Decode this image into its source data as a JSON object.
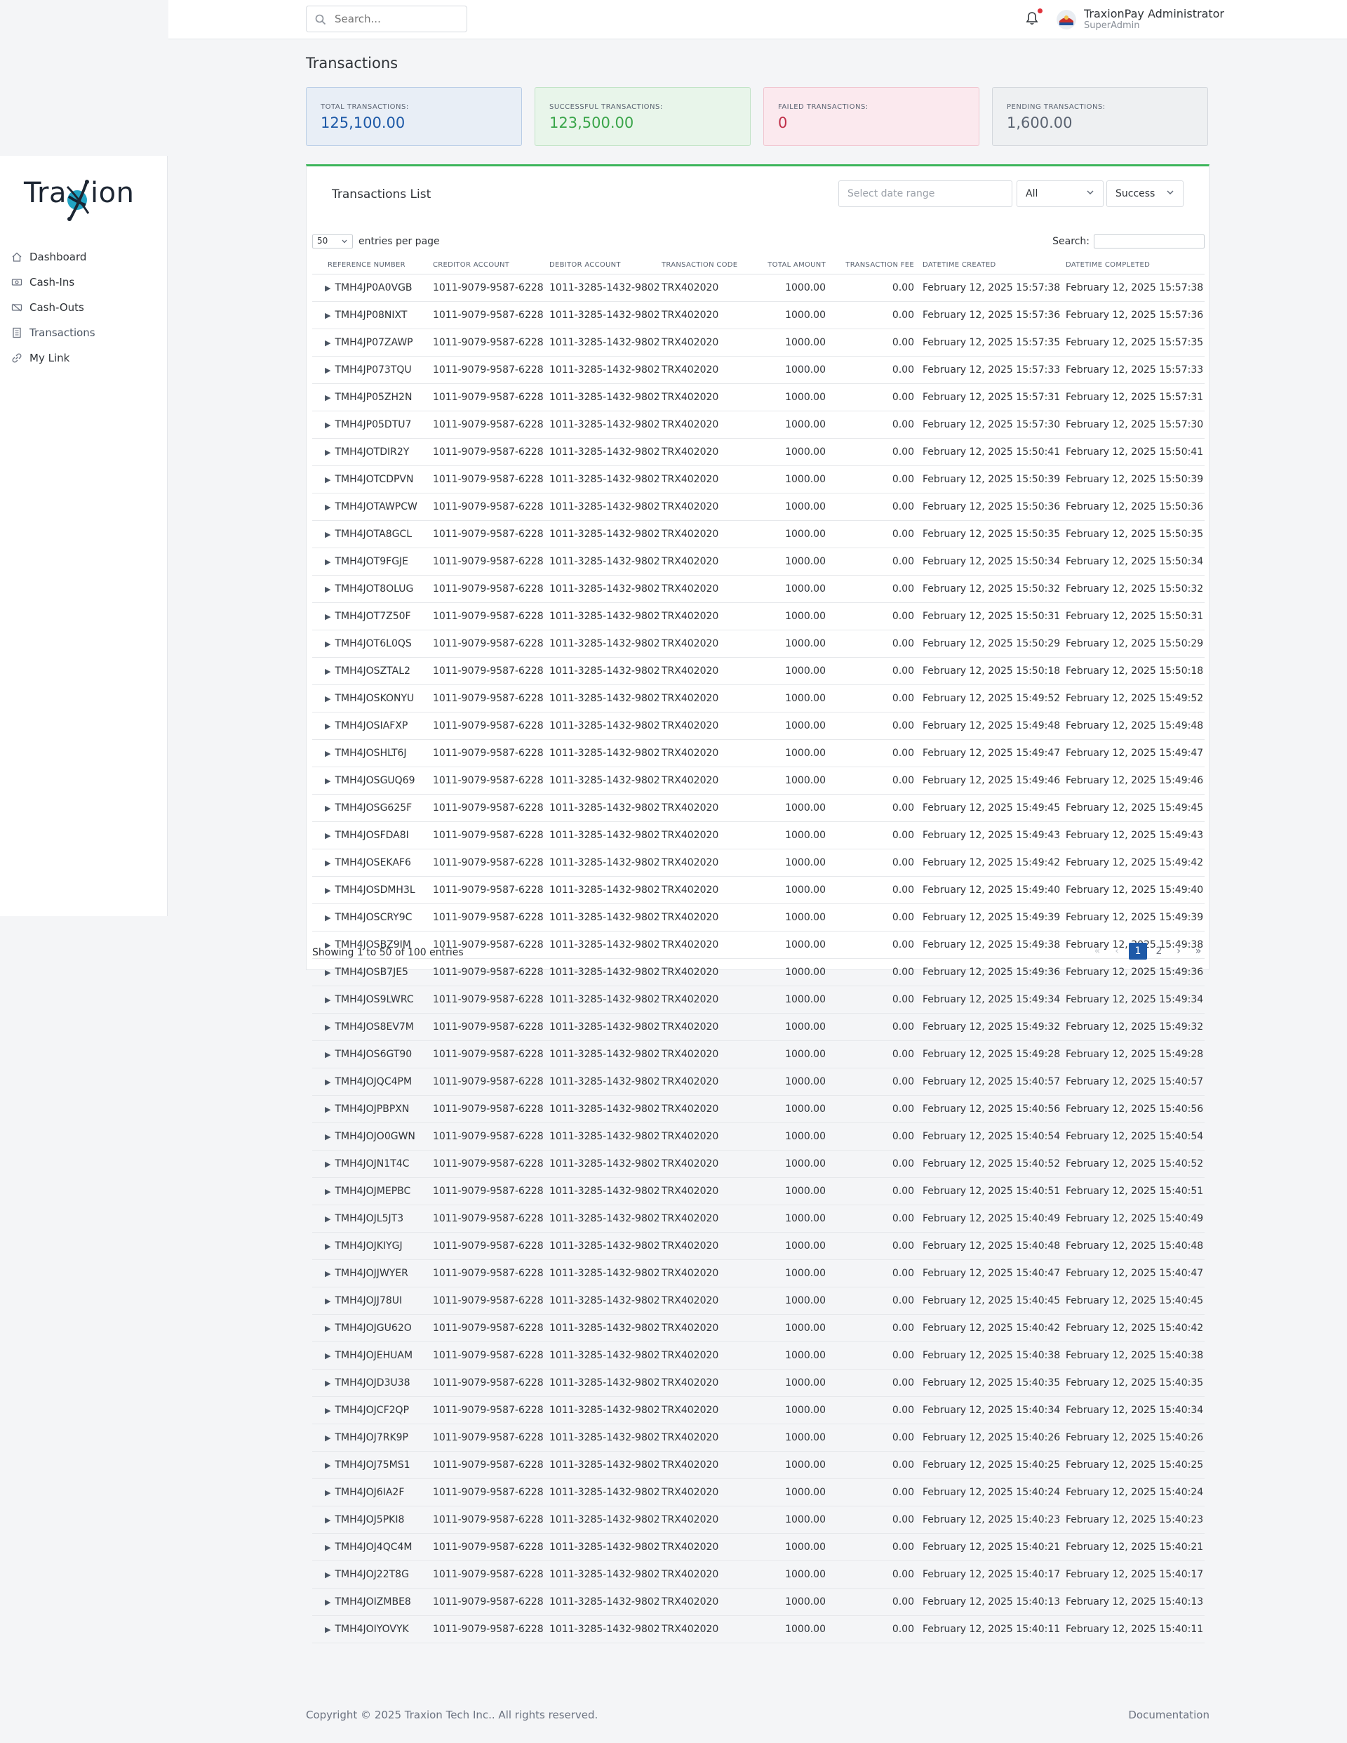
{
  "topbar": {
    "search_placeholder": "Search...",
    "user_name": "TraxionPay Administrator",
    "user_role": "SuperAdmin"
  },
  "sidebar": {
    "logo_text_left": "Tra",
    "logo_text_right": "ion",
    "items": [
      {
        "label": "Dashboard",
        "icon": "home-icon"
      },
      {
        "label": "Cash-Ins",
        "icon": "cash-in-icon"
      },
      {
        "label": "Cash-Outs",
        "icon": "cash-out-icon"
      },
      {
        "label": "Transactions",
        "icon": "receipt-icon",
        "active": true
      },
      {
        "label": "My Link",
        "icon": "link-icon"
      }
    ]
  },
  "page": {
    "title": "Transactions"
  },
  "summary_cards": [
    {
      "label": "TOTAL TRANSACTIONS:",
      "value": "125,100.00",
      "color": "#1e5aa8",
      "bg": "#e8eef6",
      "border": "#b9cde6"
    },
    {
      "label": "SUCCESSFUL TRANSACTIONS:",
      "value": "123,500.00",
      "color": "#3aa54a",
      "bg": "#e8f5ea",
      "border": "#c1e3c6"
    },
    {
      "label": "FAILED TRANSACTIONS:",
      "value": "0",
      "color": "#c0314a",
      "bg": "#fbe9ee",
      "border": "#f0c5cf"
    },
    {
      "label": "PENDING TRANSACTIONS:",
      "value": "1,600.00",
      "color": "#5b6472",
      "bg": "#eef0f2",
      "border": "#d3d7dc"
    }
  ],
  "panel": {
    "title": "Transactions List",
    "date_range_placeholder": "Select date range",
    "type_filter": "All",
    "status_filter": "Success",
    "entries_per_page": "50",
    "entries_label": "entries per page",
    "search_label": "Search:"
  },
  "table": {
    "columns": [
      "REFERENCE NUMBER",
      "CREDITOR ACCOUNT",
      "DEBITOR ACCOUNT",
      "TRANSACTION CODE",
      "TOTAL AMOUNT",
      "TRANSACTION FEE",
      "DATETIME CREATED",
      "DATETIME COMPLETED"
    ],
    "creditor": "1011-9079-9587-6228",
    "debitor": "1011-3285-1432-9802",
    "code": "TRX402020",
    "amount": "1000.00",
    "fee": "0.00",
    "rows": [
      {
        "ref": "TMH4JP0A0VGB",
        "created": "February 12, 2025 15:57:38",
        "completed": "February 12, 2025 15:57:38"
      },
      {
        "ref": "TMH4JP08NIXT",
        "created": "February 12, 2025 15:57:36",
        "completed": "February 12, 2025 15:57:36"
      },
      {
        "ref": "TMH4JP07ZAWP",
        "created": "February 12, 2025 15:57:35",
        "completed": "February 12, 2025 15:57:35"
      },
      {
        "ref": "TMH4JP073TQU",
        "created": "February 12, 2025 15:57:33",
        "completed": "February 12, 2025 15:57:33"
      },
      {
        "ref": "TMH4JP05ZH2N",
        "created": "February 12, 2025 15:57:31",
        "completed": "February 12, 2025 15:57:31"
      },
      {
        "ref": "TMH4JP05DTU7",
        "created": "February 12, 2025 15:57:30",
        "completed": "February 12, 2025 15:57:30"
      },
      {
        "ref": "TMH4JOTDIR2Y",
        "created": "February 12, 2025 15:50:41",
        "completed": "February 12, 2025 15:50:41"
      },
      {
        "ref": "TMH4JOTCDPVN",
        "created": "February 12, 2025 15:50:39",
        "completed": "February 12, 2025 15:50:39"
      },
      {
        "ref": "TMH4JOTAWPCW",
        "created": "February 12, 2025 15:50:36",
        "completed": "February 12, 2025 15:50:36"
      },
      {
        "ref": "TMH4JOTA8GCL",
        "created": "February 12, 2025 15:50:35",
        "completed": "February 12, 2025 15:50:35"
      },
      {
        "ref": "TMH4JOT9FGJE",
        "created": "February 12, 2025 15:50:34",
        "completed": "February 12, 2025 15:50:34"
      },
      {
        "ref": "TMH4JOT8OLUG",
        "created": "February 12, 2025 15:50:32",
        "completed": "February 12, 2025 15:50:32"
      },
      {
        "ref": "TMH4JOT7Z50F",
        "created": "February 12, 2025 15:50:31",
        "completed": "February 12, 2025 15:50:31"
      },
      {
        "ref": "TMH4JOT6L0QS",
        "created": "February 12, 2025 15:50:29",
        "completed": "February 12, 2025 15:50:29"
      },
      {
        "ref": "TMH4JOSZTAL2",
        "created": "February 12, 2025 15:50:18",
        "completed": "February 12, 2025 15:50:18"
      },
      {
        "ref": "TMH4JOSKONYU",
        "created": "February 12, 2025 15:49:52",
        "completed": "February 12, 2025 15:49:52"
      },
      {
        "ref": "TMH4JOSIAFXP",
        "created": "February 12, 2025 15:49:48",
        "completed": "February 12, 2025 15:49:48"
      },
      {
        "ref": "TMH4JOSHLT6J",
        "created": "February 12, 2025 15:49:47",
        "completed": "February 12, 2025 15:49:47"
      },
      {
        "ref": "TMH4JOSGUQ69",
        "created": "February 12, 2025 15:49:46",
        "completed": "February 12, 2025 15:49:46"
      },
      {
        "ref": "TMH4JOSG625F",
        "created": "February 12, 2025 15:49:45",
        "completed": "February 12, 2025 15:49:45"
      },
      {
        "ref": "TMH4JOSFDA8I",
        "created": "February 12, 2025 15:49:43",
        "completed": "February 12, 2025 15:49:43"
      },
      {
        "ref": "TMH4JOSEKAF6",
        "created": "February 12, 2025 15:49:42",
        "completed": "February 12, 2025 15:49:42"
      },
      {
        "ref": "TMH4JOSDMH3L",
        "created": "February 12, 2025 15:49:40",
        "completed": "February 12, 2025 15:49:40"
      },
      {
        "ref": "TMH4JOSCRY9C",
        "created": "February 12, 2025 15:49:39",
        "completed": "February 12, 2025 15:49:39"
      },
      {
        "ref": "TMH4JOSBZ9IM",
        "created": "February 12, 2025 15:49:38",
        "completed": "February 12, 2025 15:49:38"
      },
      {
        "ref": "TMH4JOSB7JE5",
        "created": "February 12, 2025 15:49:36",
        "completed": "February 12, 2025 15:49:36"
      },
      {
        "ref": "TMH4JOS9LWRC",
        "created": "February 12, 2025 15:49:34",
        "completed": "February 12, 2025 15:49:34"
      },
      {
        "ref": "TMH4JOS8EV7M",
        "created": "February 12, 2025 15:49:32",
        "completed": "February 12, 2025 15:49:32"
      },
      {
        "ref": "TMH4JOS6GT90",
        "created": "February 12, 2025 15:49:28",
        "completed": "February 12, 2025 15:49:28"
      },
      {
        "ref": "TMH4JOJQC4PM",
        "created": "February 12, 2025 15:40:57",
        "completed": "February 12, 2025 15:40:57"
      },
      {
        "ref": "TMH4JOJPBPXN",
        "created": "February 12, 2025 15:40:56",
        "completed": "February 12, 2025 15:40:56"
      },
      {
        "ref": "TMH4JOJO0GWN",
        "created": "February 12, 2025 15:40:54",
        "completed": "February 12, 2025 15:40:54"
      },
      {
        "ref": "TMH4JOJN1T4C",
        "created": "February 12, 2025 15:40:52",
        "completed": "February 12, 2025 15:40:52"
      },
      {
        "ref": "TMH4JOJMEPBC",
        "created": "February 12, 2025 15:40:51",
        "completed": "February 12, 2025 15:40:51"
      },
      {
        "ref": "TMH4JOJL5JT3",
        "created": "February 12, 2025 15:40:49",
        "completed": "February 12, 2025 15:40:49"
      },
      {
        "ref": "TMH4JOJKIYGJ",
        "created": "February 12, 2025 15:40:48",
        "completed": "February 12, 2025 15:40:48"
      },
      {
        "ref": "TMH4JOJJWYER",
        "created": "February 12, 2025 15:40:47",
        "completed": "February 12, 2025 15:40:47"
      },
      {
        "ref": "TMH4JOJJ78UI",
        "created": "February 12, 2025 15:40:45",
        "completed": "February 12, 2025 15:40:45"
      },
      {
        "ref": "TMH4JOJGU62O",
        "created": "February 12, 2025 15:40:42",
        "completed": "February 12, 2025 15:40:42"
      },
      {
        "ref": "TMH4JOJEHUAM",
        "created": "February 12, 2025 15:40:38",
        "completed": "February 12, 2025 15:40:38"
      },
      {
        "ref": "TMH4JOJD3U38",
        "created": "February 12, 2025 15:40:35",
        "completed": "February 12, 2025 15:40:35"
      },
      {
        "ref": "TMH4JOJCF2QP",
        "created": "February 12, 2025 15:40:34",
        "completed": "February 12, 2025 15:40:34"
      },
      {
        "ref": "TMH4JOJ7RK9P",
        "created": "February 12, 2025 15:40:26",
        "completed": "February 12, 2025 15:40:26"
      },
      {
        "ref": "TMH4JOJ75MS1",
        "created": "February 12, 2025 15:40:25",
        "completed": "February 12, 2025 15:40:25"
      },
      {
        "ref": "TMH4JOJ6IA2F",
        "created": "February 12, 2025 15:40:24",
        "completed": "February 12, 2025 15:40:24"
      },
      {
        "ref": "TMH4JOJ5PKI8",
        "created": "February 12, 2025 15:40:23",
        "completed": "February 12, 2025 15:40:23"
      },
      {
        "ref": "TMH4JOJ4QC4M",
        "created": "February 12, 2025 15:40:21",
        "completed": "February 12, 2025 15:40:21"
      },
      {
        "ref": "TMH4JOJ22T8G",
        "created": "February 12, 2025 15:40:17",
        "completed": "February 12, 2025 15:40:17"
      },
      {
        "ref": "TMH4JOIZMBE8",
        "created": "February 12, 2025 15:40:13",
        "completed": "February 12, 2025 15:40:13"
      },
      {
        "ref": "TMH4JOIYOVYK",
        "created": "February 12, 2025 15:40:11",
        "completed": "February 12, 2025 15:40:11"
      }
    ]
  },
  "pagination": {
    "showing": "Showing 1 to 50 of 100 entries",
    "first": "«",
    "prev": "‹",
    "pages": [
      "1",
      "2"
    ],
    "current": "1",
    "next": "›",
    "last": "»"
  },
  "footer": {
    "copyright": "Copyright © 2025 Traxion Tech Inc.. All rights reserved.",
    "documentation": "Documentation"
  }
}
